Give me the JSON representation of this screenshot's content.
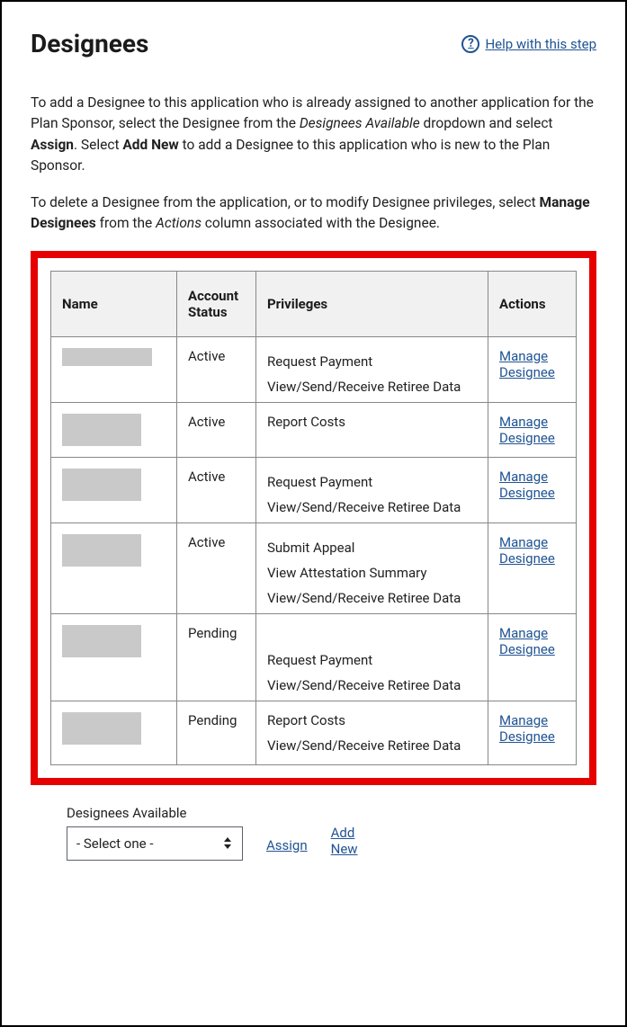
{
  "header": {
    "title": "Designees",
    "help_label": "Help with this step"
  },
  "intro": {
    "p1_a": "To add a Designee to this application who is already assigned to another application for the Plan Sponsor, select the Designee from the ",
    "p1_em1": "Designees Available",
    "p1_b": " dropdown and select ",
    "p1_strong1": "Assign",
    "p1_c": ". Select ",
    "p1_strong2": "Add New",
    "p1_d": " to add a Designee to this application who is new to the Plan Sponsor.",
    "p2_a": "To delete a Designee from the application, or to modify Designee privileges, select ",
    "p2_strong": "Manage Designees",
    "p2_b": " from the ",
    "p2_em": "Actions",
    "p2_c": " column associated with the Designee."
  },
  "table": {
    "headers": {
      "name": "Name",
      "status": "Account Status",
      "privileges": "Privileges",
      "actions": "Actions"
    },
    "rows": [
      {
        "status": "Active",
        "privileges": [
          "Request Payment",
          "View/Send/Receive Retiree Data"
        ],
        "action": "Manage Designee"
      },
      {
        "status": "Active",
        "privileges": [
          "Report Costs"
        ],
        "action": "Manage Designee"
      },
      {
        "status": "Active",
        "privileges": [
          "Request Payment",
          "View/Send/Receive Retiree Data"
        ],
        "action": "Manage Designee"
      },
      {
        "status": "Active",
        "privileges": [
          "Submit Appeal",
          "View Attestation Summary",
          "View/Send/Receive Retiree Data"
        ],
        "action": "Manage Designee"
      },
      {
        "status": "Pending",
        "privileges": [
          "Request Payment",
          "View/Send/Receive Retiree Data"
        ],
        "action": "Manage Designee"
      },
      {
        "status": "Pending",
        "privileges": [
          "Report Costs",
          "View/Send/Receive Retiree Data"
        ],
        "action": "Manage Designee"
      }
    ]
  },
  "footer": {
    "select_label": "Designees Available",
    "select_placeholder": "- Select one -",
    "assign_label": "Assign",
    "add_new_label": "Add New"
  }
}
